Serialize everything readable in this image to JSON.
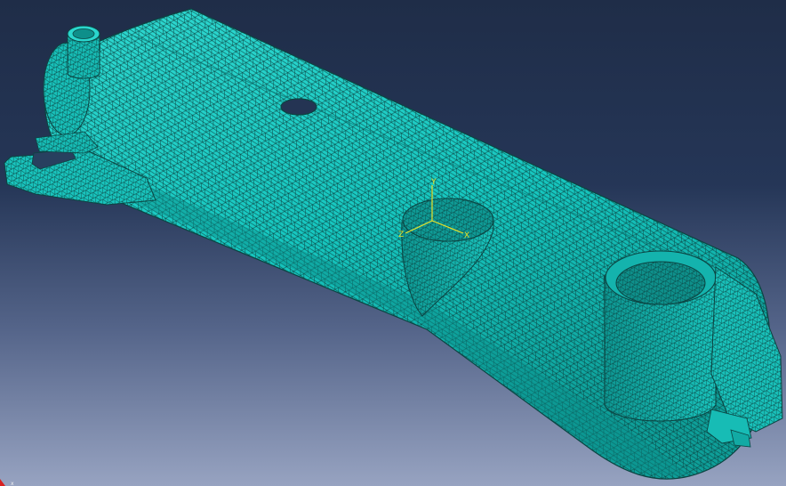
{
  "viewport": {
    "background_top": "#1f2d48",
    "background_bottom": "#97a3c1"
  },
  "model": {
    "part_color": "#15c9c2",
    "edge_color": "#0a3e3c",
    "shade_color": "#0f9a95",
    "highlight_color": "#3fe4dc"
  },
  "csys": {
    "color": "#e8e22a",
    "labels": {
      "x": "X",
      "y": "Y",
      "z": "Z"
    }
  },
  "view_triad": {
    "x_color": "#d82020",
    "visible_label": "x"
  }
}
